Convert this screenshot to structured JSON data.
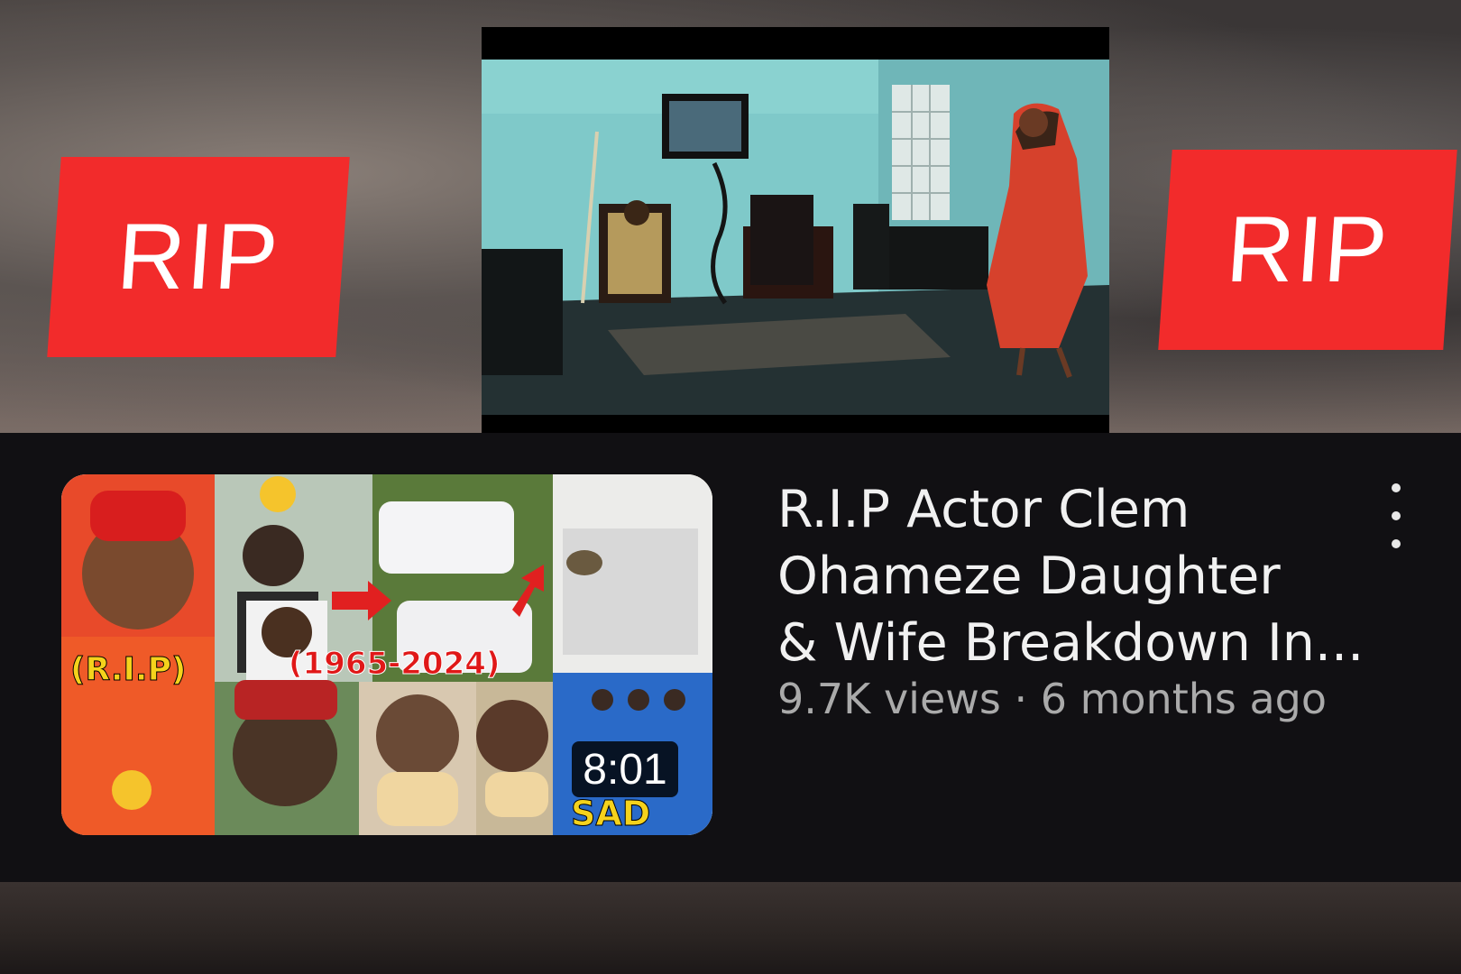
{
  "overlay": {
    "left_badge": "RIP",
    "right_badge": "RIP"
  },
  "video": {
    "title_lines": [
      "R.I.P Actor Clem",
      "Ohameze Daughter",
      "& Wife Breakdown In..."
    ],
    "meta": "9.7K views · 6 months ago",
    "duration": "8:01",
    "thumbnail_text": {
      "rip": "(R.I.P)",
      "years": "(1965-2024)",
      "sad": "SAD"
    }
  },
  "icons": {
    "more": "kebab-vertical-icon"
  },
  "colors": {
    "badge_red": "#f22b2b",
    "card_bg": "#111013",
    "title": "#f1f1f1",
    "meta": "#aaaaaa"
  }
}
